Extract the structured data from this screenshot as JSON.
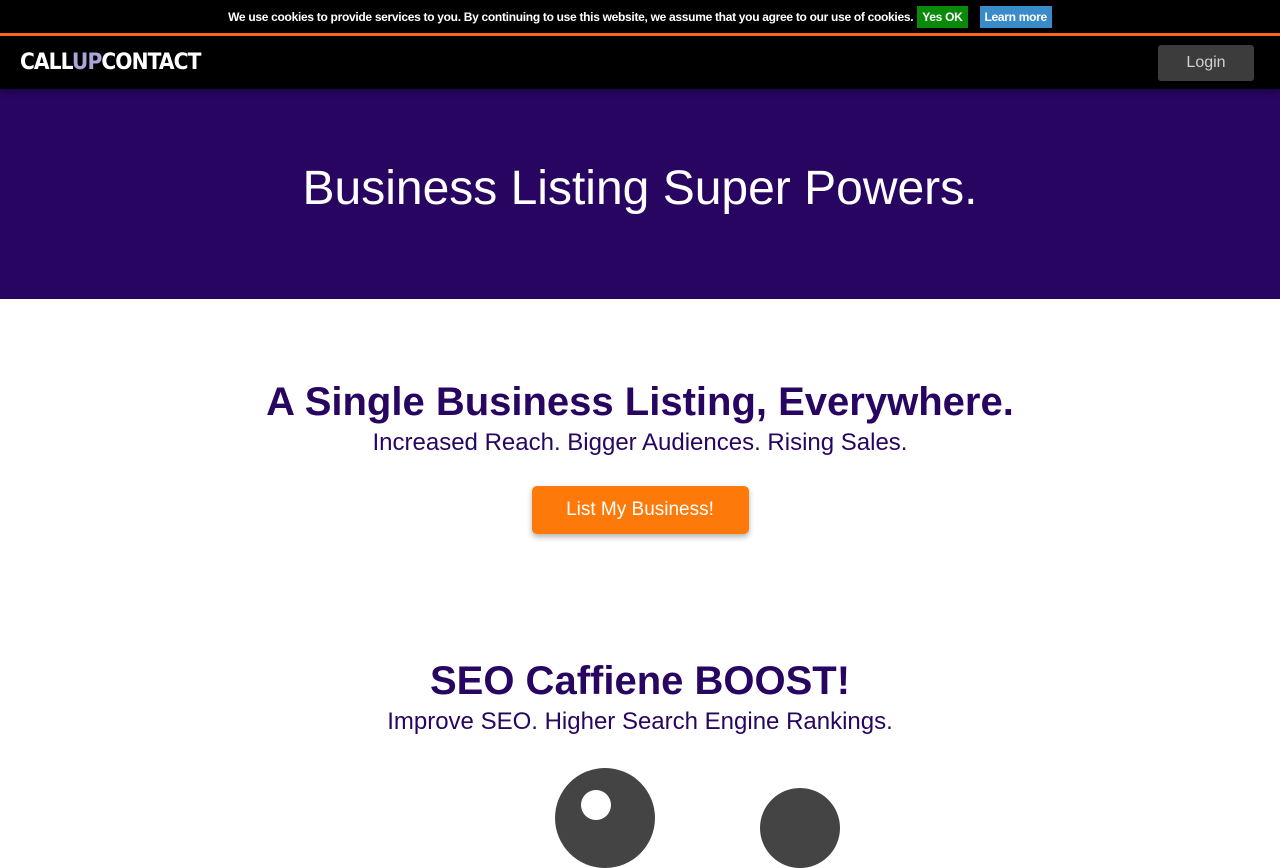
{
  "cookie_bar": {
    "message": "We use cookies to provide services to you. By continuing to use this website, we assume that you agree to our use of cookies.",
    "ok_label": "Yes OK",
    "learn_more_label": "Learn more"
  },
  "header": {
    "logo": {
      "part1": "CALL",
      "part2": "UP",
      "part3": "CONTACT"
    },
    "login_label": "Login"
  },
  "hero": {
    "title": "Business Listing Super Powers."
  },
  "sections": [
    {
      "title": "A Single Business Listing, Everywhere.",
      "subtitle": "Increased Reach. Bigger Audiences. Rising Sales.",
      "button_label": "List My Business!"
    },
    {
      "title": "SEO Caffiene BOOST!",
      "subtitle": "Improve SEO. Higher Search Engine Rankings."
    }
  ],
  "colors": {
    "brand_purple": "#270561",
    "accent_orange": "#fd7a0a",
    "header_border": "#f26b1d",
    "cookie_ok": "#0a8a0a",
    "cookie_learn": "#3a8cc8"
  },
  "icons": [
    "location-pin-icon",
    "user-icon"
  ]
}
